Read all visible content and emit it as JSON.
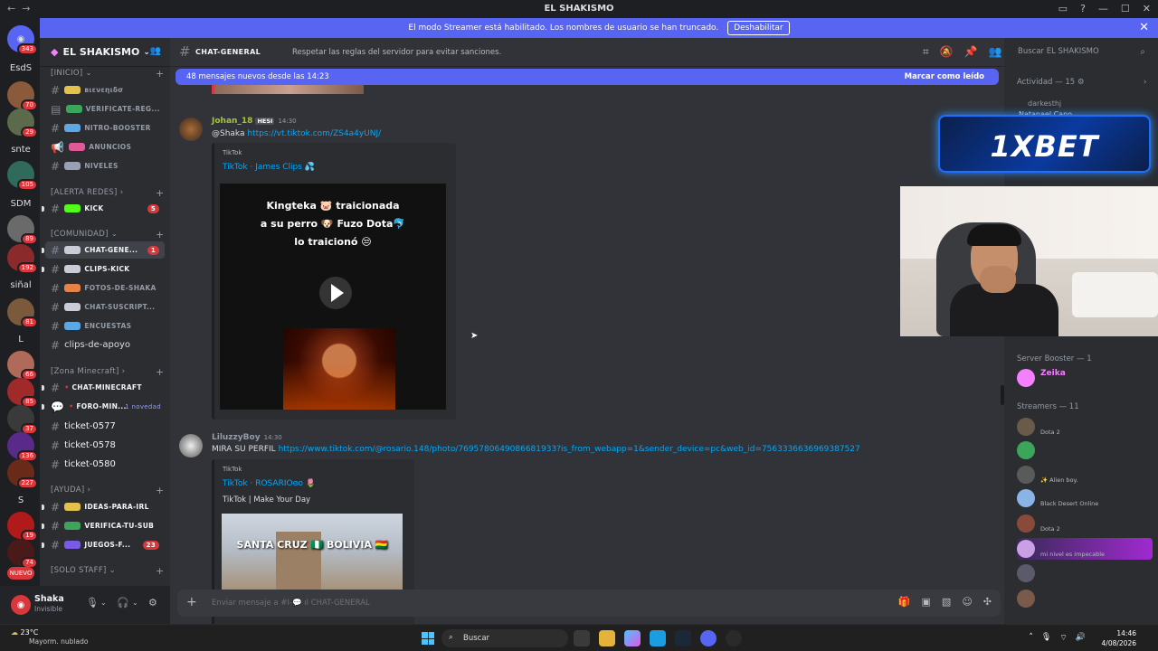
{
  "window": {
    "title": "EL SHAKISMO"
  },
  "banner": {
    "text": "El modo Streamer está habilitado. Los nombres de usuario se han truncado.",
    "button": "Deshabilitar"
  },
  "rail": {
    "items": [
      {
        "label": "",
        "badge": "343"
      },
      {
        "label": "EsdS",
        "badge": ""
      },
      {
        "label": "",
        "badge": "70"
      },
      {
        "label": "",
        "badge": "29"
      },
      {
        "label": "snte",
        "badge": ""
      },
      {
        "label": "",
        "badge": "105"
      },
      {
        "label": "SDM",
        "badge": ""
      },
      {
        "label": "",
        "badge": "89"
      },
      {
        "label": "",
        "badge": "192"
      },
      {
        "label": "siñal",
        "badge": ""
      },
      {
        "label": "",
        "badge": "81"
      },
      {
        "label": "L",
        "badge": ""
      },
      {
        "label": "",
        "badge": "66"
      },
      {
        "label": "",
        "badge": "85"
      },
      {
        "label": "",
        "badge": "37"
      },
      {
        "label": "",
        "badge": "136"
      },
      {
        "label": "",
        "badge": "227"
      },
      {
        "label": "S",
        "badge": ""
      },
      {
        "label": "",
        "badge": "19"
      },
      {
        "label": "",
        "badge": "74"
      },
      {
        "label": "NUEVO",
        "badge": ""
      }
    ]
  },
  "sidebar": {
    "server_name": "EL SHAKISMO",
    "categories": {
      "inicio": "[INICIO]",
      "alerta": "[ALERTA REDES]",
      "comunidad": "[COMUNIDAD]",
      "minecraft": "[Zona Minecraft]",
      "ayuda": "[AYUDA]",
      "staff": "[SOLO STAFF]"
    },
    "channels": [
      {
        "name": "вιενεηιδσ",
        "count": "",
        "note": ""
      },
      {
        "name": "VERIFICATE-REG...",
        "count": "",
        "note": ""
      },
      {
        "name": "NITRO-BOOSTER",
        "count": "",
        "note": ""
      },
      {
        "name": "ANUNCIOS",
        "count": "",
        "note": ""
      },
      {
        "name": "NIVELES",
        "count": "",
        "note": ""
      },
      {
        "name": "KICK",
        "count": "5",
        "note": ""
      },
      {
        "name": "CHAT-GENE...",
        "count": "1",
        "note": ""
      },
      {
        "name": "CLIPS-KICK",
        "count": "",
        "note": ""
      },
      {
        "name": "FOTOS-DE-SHAKA",
        "count": "",
        "note": ""
      },
      {
        "name": "CHAT-SUSCRIPT...",
        "count": "",
        "note": ""
      },
      {
        "name": "ENCUESTAS",
        "count": "",
        "note": ""
      },
      {
        "name": "clips-de-apoyo",
        "count": "",
        "note": ""
      },
      {
        "name": "CHAT-MINECRAFT",
        "count": "",
        "note": ""
      },
      {
        "name": "FORO-MIN...",
        "count": "",
        "note": "1 novedad"
      },
      {
        "name": "ticket-0577",
        "count": "",
        "note": ""
      },
      {
        "name": "ticket-0578",
        "count": "",
        "note": ""
      },
      {
        "name": "ticket-0580",
        "count": "",
        "note": ""
      },
      {
        "name": "IDEAS-PARA-IRL",
        "count": "",
        "note": ""
      },
      {
        "name": "VERIFICA-TU-SUB",
        "count": "",
        "note": ""
      },
      {
        "name": "JUEGOS-F...",
        "count": "23",
        "note": ""
      }
    ]
  },
  "user": {
    "name": "Shaka",
    "status": "Invisible"
  },
  "channel": {
    "name": "CHAT-GENERAL",
    "topic": "Respetar las reglas del servidor para evitar sanciones.",
    "new_messages": "48 mensajes nuevos desde las 14:23",
    "mark_read": "Marcar como leído"
  },
  "messages": [
    {
      "author": "Johan_18",
      "tag": "HESI",
      "time": "14:30",
      "mention": "@Shaka",
      "link": "https://vt.tiktok.com/ZS4a4yUNJ/",
      "embed": {
        "provider": "TikTok",
        "title": "TikTok · James Clips 💦",
        "desc": "",
        "caption": [
          "Kingteka 🐷 traicionada",
          "a su perro 🐶 Fuzo Dota🐬",
          "lo traicionó 😒"
        ]
      }
    },
    {
      "author": "LiluzzyBoy",
      "tag": "",
      "time": "14:30",
      "mention": "MIRA SU PERFIL",
      "link": "https://www.tiktok.com/@rosario.148/photo/7695780649086681933?is_from_webapp=1&sender_device=pc&web_id=7563336636969387527",
      "embed": {
        "provider": "TikTok",
        "title": "TikTok · ROSARIOɞo 🌷",
        "desc": "TikTok | Make Your Day",
        "caption": [
          "SANTA CRUZ 🇳🇬 BOLIVIA 🇧🇴"
        ]
      }
    }
  ],
  "composer": {
    "placeholder": "Enviar mensaje a #I-💬 ıl CHAT-GENERAL"
  },
  "members": {
    "search_placeholder": "Buscar EL SHAKISMO",
    "activity": "Actividad — 15",
    "activity_user": "darkesthj",
    "activity_user2": "Natanael Cano",
    "groups": [
      {
        "label": "Server Booster — 1"
      },
      {
        "label": "Streamers — 11"
      }
    ],
    "list": [
      {
        "name": "Zeika",
        "status": "",
        "color": "#f47fff"
      },
      {
        "name": "",
        "status": "Dota 2",
        "color": "#a970ff"
      },
      {
        "name": "",
        "status": "",
        "color": "#a970ff"
      },
      {
        "name": "",
        "status": "✨ Alien boy.",
        "color": "#a970ff"
      },
      {
        "name": "",
        "status": "Black Desert Online",
        "color": "#a970ff"
      },
      {
        "name": "",
        "status": "Dota 2",
        "color": "#a970ff"
      },
      {
        "name": "",
        "status": "mi nivel es impecable",
        "color": "#a970ff"
      },
      {
        "name": "",
        "status": "",
        "color": "#a970ff"
      },
      {
        "name": "",
        "status": "",
        "color": "#a970ff"
      }
    ]
  },
  "ad": {
    "brand": "1XBET"
  },
  "taskbar": {
    "temp": "23°C",
    "weather": "Mayorm. nublado",
    "search": "Buscar",
    "time": "14:46",
    "date": "4/08/2026"
  },
  "colors": {
    "accent": "#5865f2",
    "sidebar": "#2b2d31",
    "main": "#313338",
    "badge": "#da373c",
    "link": "#00a8fc"
  }
}
